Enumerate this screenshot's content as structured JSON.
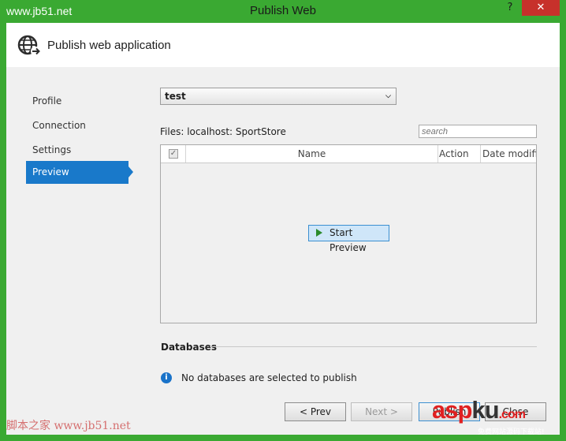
{
  "window": {
    "title": "Publish Web",
    "help_glyph": "?",
    "close_glyph": "✕",
    "watermark_top": "www.jb51.net",
    "frame_color": "#3aa932"
  },
  "header": {
    "title": "Publish web application"
  },
  "nav": {
    "items": [
      {
        "label": "Profile"
      },
      {
        "label": "Connection"
      },
      {
        "label": "Settings"
      },
      {
        "label": "Preview"
      }
    ],
    "active": "Preview",
    "accent": "#1979ca"
  },
  "profile": {
    "selected": "test"
  },
  "files": {
    "label": "Files:  localhost: SportStore",
    "search_placeholder": "search",
    "columns": [
      "Name",
      "Action",
      "Date modifie"
    ],
    "start_preview_label": "Start Preview"
  },
  "databases": {
    "heading": "Databases",
    "message": "No databases are selected to publish"
  },
  "buttons": {
    "prev": "< Prev",
    "next": "Next >",
    "publish": "Publish",
    "close": "Close"
  },
  "watermarks": {
    "bottom_left": "脚本之家  www.jb51.net",
    "logo_main": "asp",
    "logo_ku": "ku",
    "logo_com": ".com",
    "logo_sub": "免费网站源码下载站!"
  }
}
